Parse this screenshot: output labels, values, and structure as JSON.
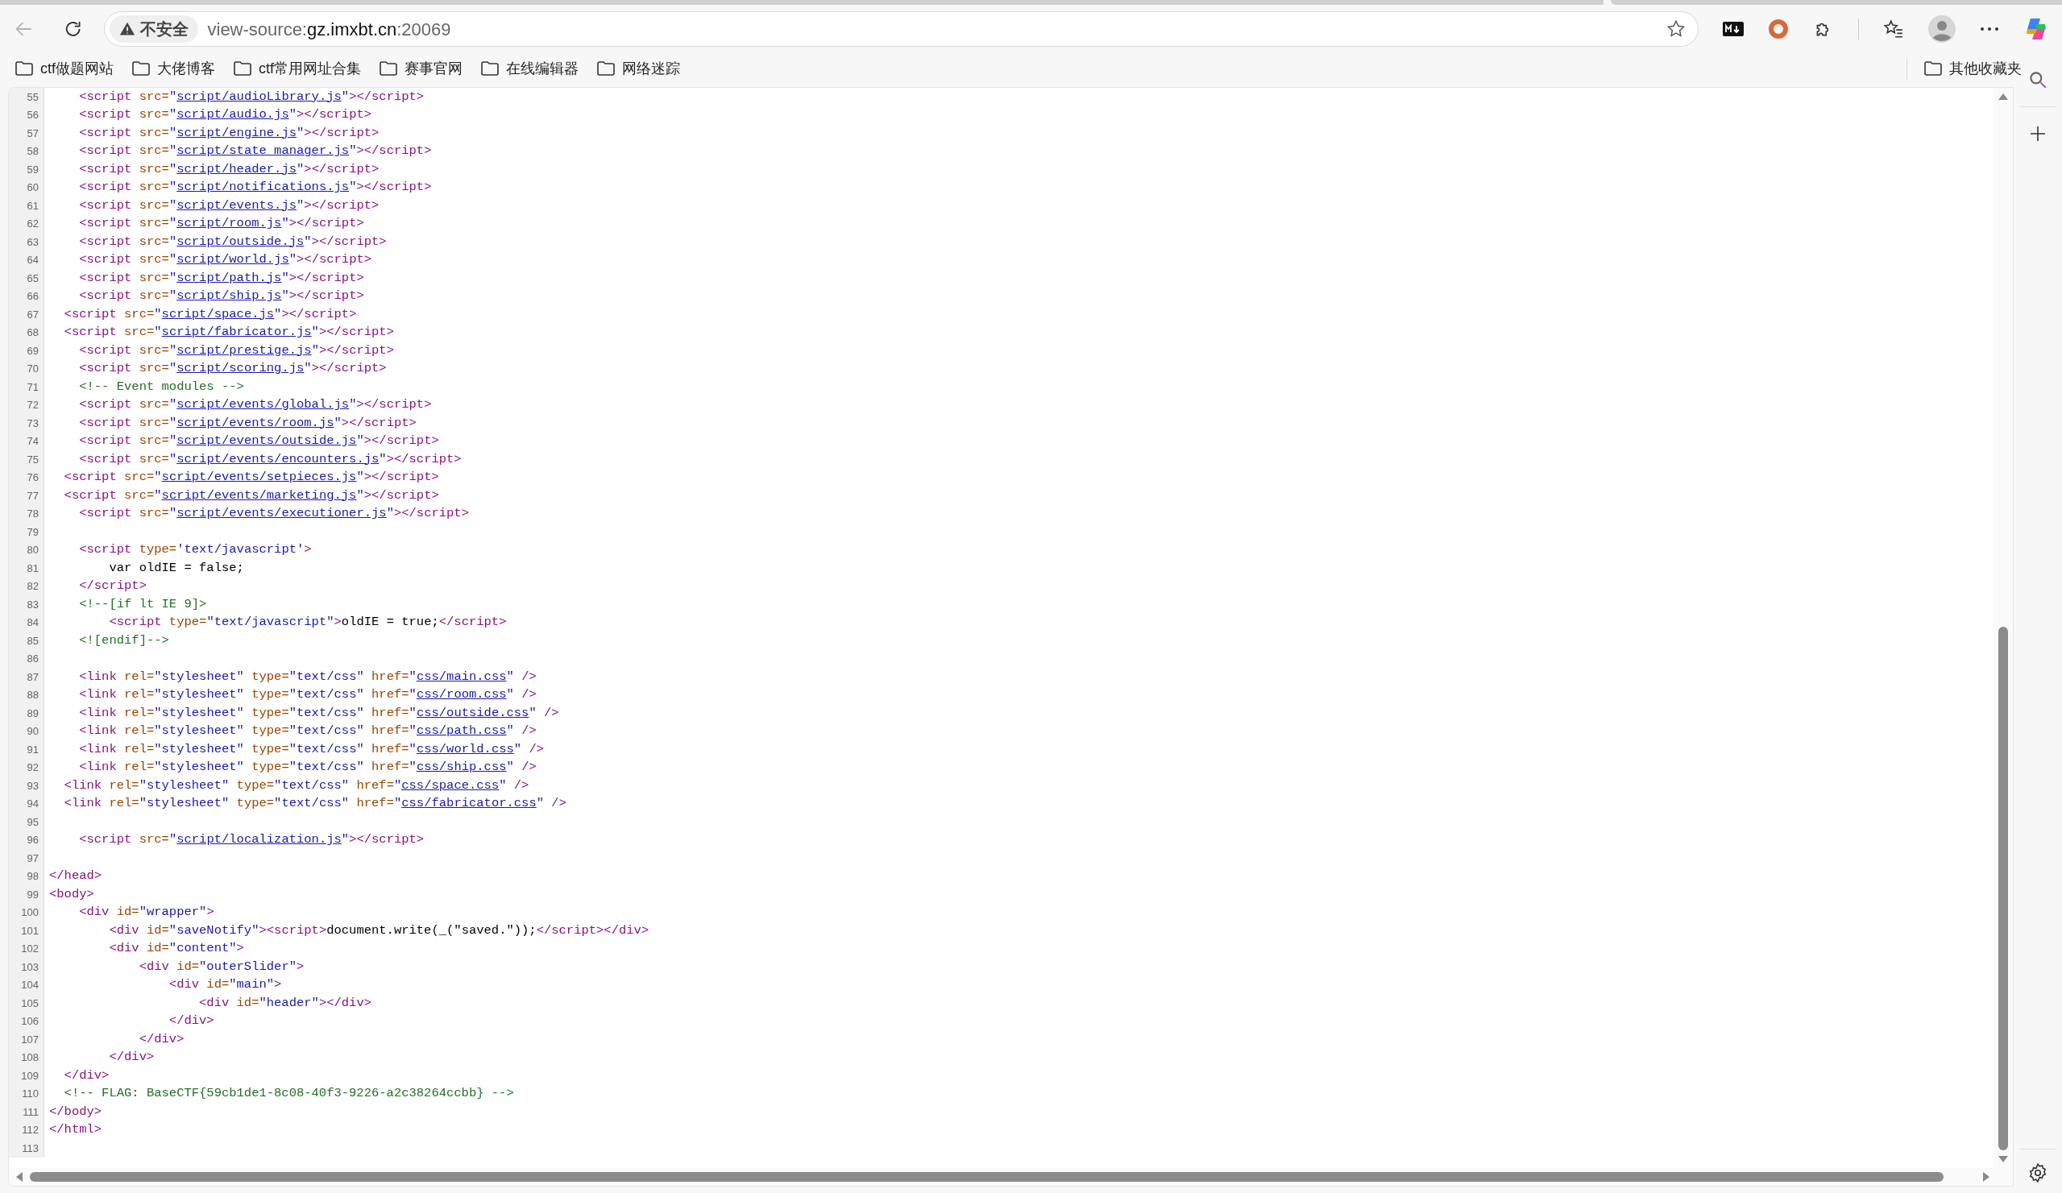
{
  "toolbar": {
    "security_label": "不安全",
    "url_prefix": "view-source:",
    "url_host": "gz.imxbt.cn",
    "url_suffix": ":20069"
  },
  "bookmarks": [
    "ctf做题网站",
    "大佬博客",
    "ctf常用网址合集",
    "赛事官网",
    "在线编辑器",
    "网络迷踪"
  ],
  "other_bookmarks": "其他收藏夹",
  "lines": [
    {
      "number": "55",
      "tokens": [
        {
          "kind": "tag",
          "text": "    <script"
        },
        {
          "kind": "attr",
          "text": " src="
        },
        {
          "kind": "value",
          "text": "\""
        },
        {
          "kind": "link",
          "text": "script/audioLibrary.js"
        },
        {
          "kind": "value",
          "text": "\""
        },
        {
          "kind": "tag",
          "text": "></script>"
        }
      ]
    },
    {
      "number": "56",
      "tokens": [
        {
          "kind": "tag",
          "text": "    <script"
        },
        {
          "kind": "attr",
          "text": " src="
        },
        {
          "kind": "value",
          "text": "\""
        },
        {
          "kind": "link",
          "text": "script/audio.js"
        },
        {
          "kind": "value",
          "text": "\""
        },
        {
          "kind": "tag",
          "text": "></script>"
        }
      ]
    },
    {
      "number": "57",
      "tokens": [
        {
          "kind": "tag",
          "text": "    <script"
        },
        {
          "kind": "attr",
          "text": " src="
        },
        {
          "kind": "value",
          "text": "\""
        },
        {
          "kind": "link",
          "text": "script/engine.js"
        },
        {
          "kind": "value",
          "text": "\""
        },
        {
          "kind": "tag",
          "text": "></script>"
        }
      ]
    },
    {
      "number": "58",
      "tokens": [
        {
          "kind": "tag",
          "text": "    <script"
        },
        {
          "kind": "attr",
          "text": " src="
        },
        {
          "kind": "value",
          "text": "\""
        },
        {
          "kind": "link",
          "text": "script/state_manager.js"
        },
        {
          "kind": "value",
          "text": "\""
        },
        {
          "kind": "tag",
          "text": "></script>"
        }
      ]
    },
    {
      "number": "59",
      "tokens": [
        {
          "kind": "tag",
          "text": "    <script"
        },
        {
          "kind": "attr",
          "text": " src="
        },
        {
          "kind": "value",
          "text": "\""
        },
        {
          "kind": "link",
          "text": "script/header.js"
        },
        {
          "kind": "value",
          "text": "\""
        },
        {
          "kind": "tag",
          "text": "></script>"
        }
      ]
    },
    {
      "number": "60",
      "tokens": [
        {
          "kind": "tag",
          "text": "    <script"
        },
        {
          "kind": "attr",
          "text": " src="
        },
        {
          "kind": "value",
          "text": "\""
        },
        {
          "kind": "link",
          "text": "script/notifications.js"
        },
        {
          "kind": "value",
          "text": "\""
        },
        {
          "kind": "tag",
          "text": "></script>"
        }
      ]
    },
    {
      "number": "61",
      "tokens": [
        {
          "kind": "tag",
          "text": "    <script"
        },
        {
          "kind": "attr",
          "text": " src="
        },
        {
          "kind": "value",
          "text": "\""
        },
        {
          "kind": "link",
          "text": "script/events.js"
        },
        {
          "kind": "value",
          "text": "\""
        },
        {
          "kind": "tag",
          "text": "></script>"
        }
      ]
    },
    {
      "number": "62",
      "tokens": [
        {
          "kind": "tag",
          "text": "    <script"
        },
        {
          "kind": "attr",
          "text": " src="
        },
        {
          "kind": "value",
          "text": "\""
        },
        {
          "kind": "link",
          "text": "script/room.js"
        },
        {
          "kind": "value",
          "text": "\""
        },
        {
          "kind": "tag",
          "text": "></script>"
        }
      ]
    },
    {
      "number": "63",
      "tokens": [
        {
          "kind": "tag",
          "text": "    <script"
        },
        {
          "kind": "attr",
          "text": " src="
        },
        {
          "kind": "value",
          "text": "\""
        },
        {
          "kind": "link",
          "text": "script/outside.js"
        },
        {
          "kind": "value",
          "text": "\""
        },
        {
          "kind": "tag",
          "text": "></script>"
        }
      ]
    },
    {
      "number": "64",
      "tokens": [
        {
          "kind": "tag",
          "text": "    <script"
        },
        {
          "kind": "attr",
          "text": " src="
        },
        {
          "kind": "value",
          "text": "\""
        },
        {
          "kind": "link",
          "text": "script/world.js"
        },
        {
          "kind": "value",
          "text": "\""
        },
        {
          "kind": "tag",
          "text": "></script>"
        }
      ]
    },
    {
      "number": "65",
      "tokens": [
        {
          "kind": "tag",
          "text": "    <script"
        },
        {
          "kind": "attr",
          "text": " src="
        },
        {
          "kind": "value",
          "text": "\""
        },
        {
          "kind": "link",
          "text": "script/path.js"
        },
        {
          "kind": "value",
          "text": "\""
        },
        {
          "kind": "tag",
          "text": "></script>"
        }
      ]
    },
    {
      "number": "66",
      "tokens": [
        {
          "kind": "tag",
          "text": "    <script"
        },
        {
          "kind": "attr",
          "text": " src="
        },
        {
          "kind": "value",
          "text": "\""
        },
        {
          "kind": "link",
          "text": "script/ship.js"
        },
        {
          "kind": "value",
          "text": "\""
        },
        {
          "kind": "tag",
          "text": "></script>"
        }
      ]
    },
    {
      "number": "67",
      "tokens": [
        {
          "kind": "tag",
          "text": "  <script"
        },
        {
          "kind": "attr",
          "text": " src="
        },
        {
          "kind": "value",
          "text": "\""
        },
        {
          "kind": "link",
          "text": "script/space.js"
        },
        {
          "kind": "value",
          "text": "\""
        },
        {
          "kind": "tag",
          "text": "></script>"
        }
      ]
    },
    {
      "number": "68",
      "tokens": [
        {
          "kind": "tag",
          "text": "  <script"
        },
        {
          "kind": "attr",
          "text": " src="
        },
        {
          "kind": "value",
          "text": "\""
        },
        {
          "kind": "link",
          "text": "script/fabricator.js"
        },
        {
          "kind": "value",
          "text": "\""
        },
        {
          "kind": "tag",
          "text": "></script>"
        }
      ]
    },
    {
      "number": "69",
      "tokens": [
        {
          "kind": "tag",
          "text": "    <script"
        },
        {
          "kind": "attr",
          "text": " src="
        },
        {
          "kind": "value",
          "text": "\""
        },
        {
          "kind": "link",
          "text": "script/prestige.js"
        },
        {
          "kind": "value",
          "text": "\""
        },
        {
          "kind": "tag",
          "text": "></script>"
        }
      ]
    },
    {
      "number": "70",
      "tokens": [
        {
          "kind": "tag",
          "text": "    <script"
        },
        {
          "kind": "attr",
          "text": " src="
        },
        {
          "kind": "value",
          "text": "\""
        },
        {
          "kind": "link",
          "text": "script/scoring.js"
        },
        {
          "kind": "value",
          "text": "\""
        },
        {
          "kind": "tag",
          "text": "></script>"
        }
      ]
    },
    {
      "number": "71",
      "tokens": [
        {
          "kind": "comment",
          "text": "    <!-- Event modules -->"
        }
      ]
    },
    {
      "number": "72",
      "tokens": [
        {
          "kind": "tag",
          "text": "    <script"
        },
        {
          "kind": "attr",
          "text": " src="
        },
        {
          "kind": "value",
          "text": "\""
        },
        {
          "kind": "link",
          "text": "script/events/global.js"
        },
        {
          "kind": "value",
          "text": "\""
        },
        {
          "kind": "tag",
          "text": "></script>"
        }
      ]
    },
    {
      "number": "73",
      "tokens": [
        {
          "kind": "tag",
          "text": "    <script"
        },
        {
          "kind": "attr",
          "text": " src="
        },
        {
          "kind": "value",
          "text": "\""
        },
        {
          "kind": "link",
          "text": "script/events/room.js"
        },
        {
          "kind": "value",
          "text": "\""
        },
        {
          "kind": "tag",
          "text": "></script>"
        }
      ]
    },
    {
      "number": "74",
      "tokens": [
        {
          "kind": "tag",
          "text": "    <script"
        },
        {
          "kind": "attr",
          "text": " src="
        },
        {
          "kind": "value",
          "text": "\""
        },
        {
          "kind": "link",
          "text": "script/events/outside.js"
        },
        {
          "kind": "value",
          "text": "\""
        },
        {
          "kind": "tag",
          "text": "></script>"
        }
      ]
    },
    {
      "number": "75",
      "tokens": [
        {
          "kind": "tag",
          "text": "    <script"
        },
        {
          "kind": "attr",
          "text": " src="
        },
        {
          "kind": "value",
          "text": "\""
        },
        {
          "kind": "link",
          "text": "script/events/encounters.js"
        },
        {
          "kind": "value",
          "text": "\""
        },
        {
          "kind": "tag",
          "text": "></script>"
        }
      ]
    },
    {
      "number": "76",
      "tokens": [
        {
          "kind": "tag",
          "text": "  <script"
        },
        {
          "kind": "attr",
          "text": " src="
        },
        {
          "kind": "value",
          "text": "\""
        },
        {
          "kind": "link",
          "text": "script/events/setpieces.js"
        },
        {
          "kind": "value",
          "text": "\""
        },
        {
          "kind": "tag",
          "text": "></script>"
        }
      ]
    },
    {
      "number": "77",
      "tokens": [
        {
          "kind": "tag",
          "text": "  <script"
        },
        {
          "kind": "attr",
          "text": " src="
        },
        {
          "kind": "value",
          "text": "\""
        },
        {
          "kind": "link",
          "text": "script/events/marketing.js"
        },
        {
          "kind": "value",
          "text": "\""
        },
        {
          "kind": "tag",
          "text": "></script>"
        }
      ]
    },
    {
      "number": "78",
      "tokens": [
        {
          "kind": "tag",
          "text": "    <script"
        },
        {
          "kind": "attr",
          "text": " src="
        },
        {
          "kind": "value",
          "text": "\""
        },
        {
          "kind": "link",
          "text": "script/events/executioner.js"
        },
        {
          "kind": "value",
          "text": "\""
        },
        {
          "kind": "tag",
          "text": "></script>"
        }
      ]
    },
    {
      "number": "79"
    },
    {
      "number": "80",
      "tokens": [
        {
          "kind": "tag",
          "text": "    <script"
        },
        {
          "kind": "attr",
          "text": " type="
        },
        {
          "kind": "value",
          "text": "'text/javascript'"
        },
        {
          "kind": "tag",
          "text": ">"
        }
      ]
    },
    {
      "number": "81",
      "tokens": [
        {
          "kind": "text",
          "text": "        var oldIE = false;"
        }
      ]
    },
    {
      "number": "82",
      "tokens": [
        {
          "kind": "tag",
          "text": "    </script>"
        }
      ]
    },
    {
      "number": "83",
      "tokens": [
        {
          "kind": "comment",
          "text": "    <!--[if lt IE 9]>"
        }
      ]
    },
    {
      "number": "84",
      "tokens": [
        {
          "kind": "tag",
          "text": "        <script"
        },
        {
          "kind": "attr",
          "text": " type="
        },
        {
          "kind": "value",
          "text": "\"text/javascript\""
        },
        {
          "kind": "tag",
          "text": ">"
        },
        {
          "kind": "text",
          "text": "oldIE = true;"
        },
        {
          "kind": "tag",
          "text": "</script>"
        }
      ]
    },
    {
      "number": "85",
      "tokens": [
        {
          "kind": "comment",
          "text": "    <![endif]-->"
        }
      ]
    },
    {
      "number": "86"
    },
    {
      "number": "87",
      "tokens": [
        {
          "kind": "tag",
          "text": "    <link"
        },
        {
          "kind": "attr",
          "text": " rel="
        },
        {
          "kind": "value",
          "text": "\"stylesheet\""
        },
        {
          "kind": "attr",
          "text": " type="
        },
        {
          "kind": "value",
          "text": "\"text/css\""
        },
        {
          "kind": "attr",
          "text": " href="
        },
        {
          "kind": "value",
          "text": "\""
        },
        {
          "kind": "link",
          "text": "css/main.css"
        },
        {
          "kind": "value",
          "text": "\""
        },
        {
          "kind": "tag",
          "text": " />"
        }
      ]
    },
    {
      "number": "88",
      "tokens": [
        {
          "kind": "tag",
          "text": "    <link"
        },
        {
          "kind": "attr",
          "text": " rel="
        },
        {
          "kind": "value",
          "text": "\"stylesheet\""
        },
        {
          "kind": "attr",
          "text": " type="
        },
        {
          "kind": "value",
          "text": "\"text/css\""
        },
        {
          "kind": "attr",
          "text": " href="
        },
        {
          "kind": "value",
          "text": "\""
        },
        {
          "kind": "link",
          "text": "css/room.css"
        },
        {
          "kind": "value",
          "text": "\""
        },
        {
          "kind": "tag",
          "text": " />"
        }
      ]
    },
    {
      "number": "89",
      "tokens": [
        {
          "kind": "tag",
          "text": "    <link"
        },
        {
          "kind": "attr",
          "text": " rel="
        },
        {
          "kind": "value",
          "text": "\"stylesheet\""
        },
        {
          "kind": "attr",
          "text": " type="
        },
        {
          "kind": "value",
          "text": "\"text/css\""
        },
        {
          "kind": "attr",
          "text": " href="
        },
        {
          "kind": "value",
          "text": "\""
        },
        {
          "kind": "link",
          "text": "css/outside.css"
        },
        {
          "kind": "value",
          "text": "\""
        },
        {
          "kind": "tag",
          "text": " />"
        }
      ]
    },
    {
      "number": "90",
      "tokens": [
        {
          "kind": "tag",
          "text": "    <link"
        },
        {
          "kind": "attr",
          "text": " rel="
        },
        {
          "kind": "value",
          "text": "\"stylesheet\""
        },
        {
          "kind": "attr",
          "text": " type="
        },
        {
          "kind": "value",
          "text": "\"text/css\""
        },
        {
          "kind": "attr",
          "text": " href="
        },
        {
          "kind": "value",
          "text": "\""
        },
        {
          "kind": "link",
          "text": "css/path.css"
        },
        {
          "kind": "value",
          "text": "\""
        },
        {
          "kind": "tag",
          "text": " />"
        }
      ]
    },
    {
      "number": "91",
      "tokens": [
        {
          "kind": "tag",
          "text": "    <link"
        },
        {
          "kind": "attr",
          "text": " rel="
        },
        {
          "kind": "value",
          "text": "\"stylesheet\""
        },
        {
          "kind": "attr",
          "text": " type="
        },
        {
          "kind": "value",
          "text": "\"text/css\""
        },
        {
          "kind": "attr",
          "text": " href="
        },
        {
          "kind": "value",
          "text": "\""
        },
        {
          "kind": "link",
          "text": "css/world.css"
        },
        {
          "kind": "value",
          "text": "\""
        },
        {
          "kind": "tag",
          "text": " />"
        }
      ]
    },
    {
      "number": "92",
      "tokens": [
        {
          "kind": "tag",
          "text": "    <link"
        },
        {
          "kind": "attr",
          "text": " rel="
        },
        {
          "kind": "value",
          "text": "\"stylesheet\""
        },
        {
          "kind": "attr",
          "text": " type="
        },
        {
          "kind": "value",
          "text": "\"text/css\""
        },
        {
          "kind": "attr",
          "text": " href="
        },
        {
          "kind": "value",
          "text": "\""
        },
        {
          "kind": "link",
          "text": "css/ship.css"
        },
        {
          "kind": "value",
          "text": "\""
        },
        {
          "kind": "tag",
          "text": " />"
        }
      ]
    },
    {
      "number": "93",
      "tokens": [
        {
          "kind": "tag",
          "text": "  <link"
        },
        {
          "kind": "attr",
          "text": " rel="
        },
        {
          "kind": "value",
          "text": "\"stylesheet\""
        },
        {
          "kind": "attr",
          "text": " type="
        },
        {
          "kind": "value",
          "text": "\"text/css\""
        },
        {
          "kind": "attr",
          "text": " href="
        },
        {
          "kind": "value",
          "text": "\""
        },
        {
          "kind": "link",
          "text": "css/space.css"
        },
        {
          "kind": "value",
          "text": "\""
        },
        {
          "kind": "tag",
          "text": " />"
        }
      ]
    },
    {
      "number": "94",
      "tokens": [
        {
          "kind": "tag",
          "text": "  <link"
        },
        {
          "kind": "attr",
          "text": " rel="
        },
        {
          "kind": "value",
          "text": "\"stylesheet\""
        },
        {
          "kind": "attr",
          "text": " type="
        },
        {
          "kind": "value",
          "text": "\"text/css\""
        },
        {
          "kind": "attr",
          "text": " href="
        },
        {
          "kind": "value",
          "text": "\""
        },
        {
          "kind": "link",
          "text": "css/fabricator.css"
        },
        {
          "kind": "value",
          "text": "\""
        },
        {
          "kind": "tag",
          "text": " />"
        }
      ]
    },
    {
      "number": "95"
    },
    {
      "number": "96",
      "tokens": [
        {
          "kind": "tag",
          "text": "    <script"
        },
        {
          "kind": "attr",
          "text": " src="
        },
        {
          "kind": "value",
          "text": "\""
        },
        {
          "kind": "link",
          "text": "script/localization.js"
        },
        {
          "kind": "value",
          "text": "\""
        },
        {
          "kind": "tag",
          "text": "></script>"
        }
      ]
    },
    {
      "number": "97"
    },
    {
      "number": "98",
      "tokens": [
        {
          "kind": "tag",
          "text": "</head>"
        }
      ]
    },
    {
      "number": "99",
      "tokens": [
        {
          "kind": "tag",
          "text": "<body>"
        }
      ]
    },
    {
      "number": "100",
      "tokens": [
        {
          "kind": "tag",
          "text": "    <div"
        },
        {
          "kind": "attr",
          "text": " id="
        },
        {
          "kind": "value",
          "text": "\"wrapper\""
        },
        {
          "kind": "tag",
          "text": ">"
        }
      ]
    },
    {
      "number": "101",
      "tokens": [
        {
          "kind": "tag",
          "text": "        <div"
        },
        {
          "kind": "attr",
          "text": " id="
        },
        {
          "kind": "value",
          "text": "\"saveNotify\""
        },
        {
          "kind": "tag",
          "text": "><script>"
        },
        {
          "kind": "text",
          "text": "document.write(_(\"saved.\"));"
        },
        {
          "kind": "tag",
          "text": "</script></div>"
        }
      ]
    },
    {
      "number": "102",
      "tokens": [
        {
          "kind": "tag",
          "text": "        <div"
        },
        {
          "kind": "attr",
          "text": " id="
        },
        {
          "kind": "value",
          "text": "\"content\""
        },
        {
          "kind": "tag",
          "text": ">"
        }
      ]
    },
    {
      "number": "103",
      "tokens": [
        {
          "kind": "tag",
          "text": "            <div"
        },
        {
          "kind": "attr",
          "text": " id="
        },
        {
          "kind": "value",
          "text": "\"outerSlider\""
        },
        {
          "kind": "tag",
          "text": ">"
        }
      ]
    },
    {
      "number": "104",
      "tokens": [
        {
          "kind": "tag",
          "text": "                <div"
        },
        {
          "kind": "attr",
          "text": " id="
        },
        {
          "kind": "value",
          "text": "\"main\""
        },
        {
          "kind": "tag",
          "text": ">"
        }
      ]
    },
    {
      "number": "105",
      "tokens": [
        {
          "kind": "tag",
          "text": "                    <div"
        },
        {
          "kind": "attr",
          "text": " id="
        },
        {
          "kind": "value",
          "text": "\"header\""
        },
        {
          "kind": "tag",
          "text": "></div>"
        }
      ]
    },
    {
      "number": "106",
      "tokens": [
        {
          "kind": "tag",
          "text": "                </div>"
        }
      ]
    },
    {
      "number": "107",
      "tokens": [
        {
          "kind": "tag",
          "text": "            </div>"
        }
      ]
    },
    {
      "number": "108",
      "tokens": [
        {
          "kind": "tag",
          "text": "        </div>"
        }
      ]
    },
    {
      "number": "109",
      "tokens": [
        {
          "kind": "tag",
          "text": "  </div>"
        }
      ]
    },
    {
      "number": "110",
      "tokens": [
        {
          "kind": "comment",
          "text": "  <!-- FLAG: BaseCTF{59cb1de1-8c08-40f3-9226-a2c38264ccbb} -->"
        }
      ]
    },
    {
      "number": "111",
      "tokens": [
        {
          "kind": "tag",
          "text": "</body>"
        }
      ]
    },
    {
      "number": "112",
      "tokens": [
        {
          "kind": "tag",
          "text": "</html>"
        }
      ]
    },
    {
      "number": "113"
    }
  ]
}
